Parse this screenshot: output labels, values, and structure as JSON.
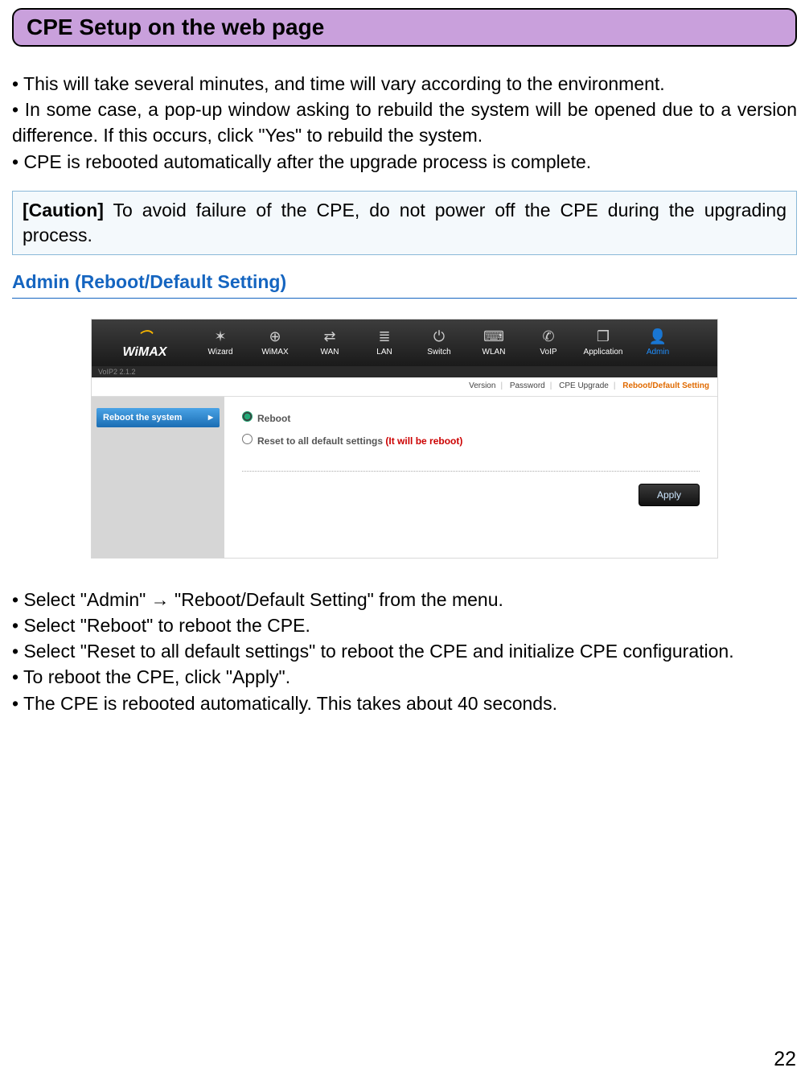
{
  "page_title": "CPE Setup on the web page",
  "intro_bullets": [
    "• This will take several minutes, and time will vary according to the environment.",
    "• In some case, a pop-up window asking to rebuild the system will be opened due to a version difference. If this occurs, click \"Yes\" to rebuild the system.",
    "• CPE is rebooted automatically after the upgrade process is complete."
  ],
  "caution": {
    "label": "[Caution]",
    "text": " To avoid failure of the CPE, do not power off the CPE during the upgrading process."
  },
  "section_heading": "Admin (Reboot/Default Setting)",
  "screenshot": {
    "logo_text": "WiMAX",
    "version_label": "VoIP2 2.1.2",
    "nav": [
      {
        "label": "Wizard",
        "icon": "✶"
      },
      {
        "label": "WiMAX",
        "icon": "⊕"
      },
      {
        "label": "WAN",
        "icon": "⇄"
      },
      {
        "label": "LAN",
        "icon": "≣"
      },
      {
        "label": "Switch",
        "icon": "⏻"
      },
      {
        "label": "WLAN",
        "icon": "⌨"
      },
      {
        "label": "VoIP",
        "icon": "✆"
      },
      {
        "label": "Application",
        "icon": "❐"
      },
      {
        "label": "Admin",
        "icon": "👤",
        "active": true
      }
    ],
    "subtabs": {
      "items": [
        "Version",
        "Password",
        "CPE Upgrade"
      ],
      "active": "Reboot/Default Setting"
    },
    "sidebar_btn": "Reboot the system",
    "options": {
      "reboot": "Reboot",
      "reset_label": "Reset to all default settings",
      "reset_warning": "(It will be reboot)"
    },
    "apply_btn": "Apply"
  },
  "instructions": [
    "• Select \"Admin\" → \"Reboot/Default Setting\" from the menu.",
    "• Select \"Reboot\" to reboot the CPE.",
    "• Select \"Reset to all default settings\" to reboot the CPE and initialize CPE configuration.",
    "• To reboot the CPE, click \"Apply\".",
    "• The CPE is rebooted automatically. This takes about 40 seconds."
  ],
  "page_number": "22"
}
